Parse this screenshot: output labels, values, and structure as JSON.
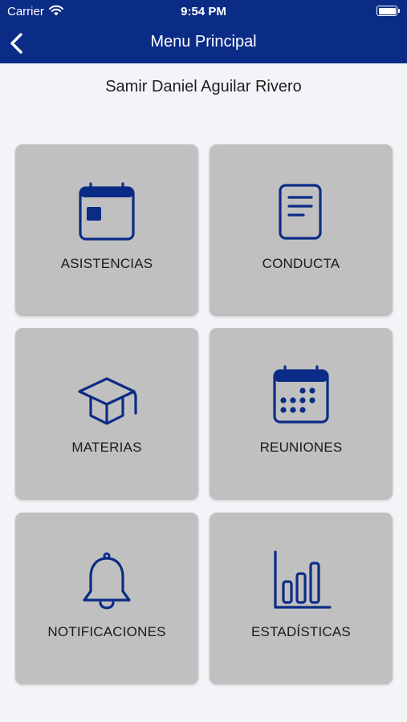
{
  "status_bar": {
    "carrier": "Carrier",
    "time": "9:54 PM",
    "wifi_icon": "wifi-icon",
    "battery_icon": "battery-icon"
  },
  "nav": {
    "title": "Menu Principal",
    "back_icon": "chevron-left-icon"
  },
  "user": {
    "name": "Samir Daniel Aguilar Rivero"
  },
  "menu": [
    {
      "label": "ASISTENCIAS",
      "icon": "calendar-card-icon"
    },
    {
      "label": "CONDUCTA",
      "icon": "document-icon"
    },
    {
      "label": "MATERIAS",
      "icon": "graduation-cap-icon"
    },
    {
      "label": "REUNIONES",
      "icon": "calendar-grid-icon"
    },
    {
      "label": "NOTIFICACIONES",
      "icon": "bell-icon"
    },
    {
      "label": "ESTADÍSTICAS",
      "icon": "bar-chart-icon"
    }
  ],
  "colors": {
    "nav_background": "#0b2c86",
    "icon_color": "#0b2c86",
    "tile_background": "#c0c0c0",
    "page_background": "#f2f4f8"
  }
}
